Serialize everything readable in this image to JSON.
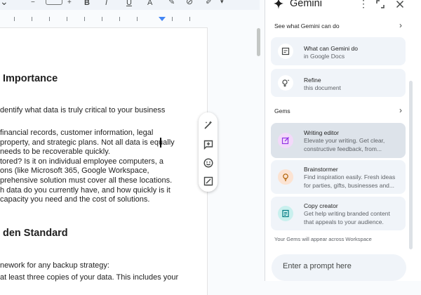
{
  "toolbar": {
    "icons": [
      "dropdown-caret",
      "text-style",
      "bold",
      "italic",
      "underline",
      "text-color",
      "highlight",
      "insert-link",
      "edit-pen"
    ]
  },
  "document": {
    "heading1": "Importance",
    "paragraph1": [
      "dentify what data is truly critical to your business"
    ],
    "paragraph2": [
      "financial records, customer information, legal",
      "property, and strategic plans. Not all data is equally",
      "needs to be recoverable quickly.",
      "tored? Is it on individual employee computers, a",
      "ons (like Microsoft 365, Google Workspace,",
      "prehensive solution must cover all these locations.",
      "h data do you currently have, and how quickly is it",
      "capacity you need and the cost of solutions."
    ],
    "heading2": "den Standard",
    "paragraph3": [
      "nework for any backup strategy:",
      "at least three copies of your data. This includes your"
    ]
  },
  "float_toolbar": [
    "magic-edit-icon",
    "add-comment-icon",
    "emoji-reaction-icon",
    "suggest-edit-icon"
  ],
  "gemini": {
    "title": "Gemini",
    "see_what_label": "See what Gemini can do",
    "cards_top": [
      {
        "title": "What can Gemini do",
        "desc": [
          "in Google Docs"
        ]
      },
      {
        "title": "Refine",
        "desc": [
          "this document"
        ]
      }
    ],
    "gems_label": "Gems",
    "gems": [
      {
        "title": "Writing editor",
        "desc": [
          "Elevate your writing. Get clear,",
          "constructive feedback, from..."
        ],
        "accent": "#f3d9fa",
        "selected": true
      },
      {
        "title": "Brainstormer",
        "desc": [
          "Find inspiration easily. Fresh ideas",
          "for parties, gifts, businesses and..."
        ],
        "accent": "#fce3d2",
        "selected": false
      },
      {
        "title": "Copy creator",
        "desc": [
          "Get help writing branded content",
          "that appeals to your audience."
        ],
        "accent": "#c9f0ee",
        "selected": false
      }
    ],
    "footer_note": "Your Gems will appear across Workspace",
    "prompt_placeholder": "Enter a prompt here"
  },
  "colors": {
    "panel_card": "#f0f4f9",
    "selected_card": "#dde3ea",
    "accent_blue": "#4285f4"
  }
}
